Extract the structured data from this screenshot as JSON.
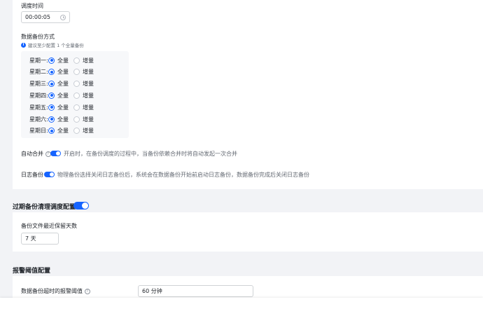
{
  "schedule": {
    "time_label": "调度时间",
    "time_value": "00:00:05"
  },
  "backup_mode": {
    "label": "数据备份方式",
    "hint": "建议至少配置 1 个全量备份",
    "options": {
      "full": "全量",
      "incremental": "增量"
    },
    "days": [
      {
        "label": "星期一:",
        "selected": "full"
      },
      {
        "label": "星期二:",
        "selected": "full"
      },
      {
        "label": "星期三:",
        "selected": "full"
      },
      {
        "label": "星期四:",
        "selected": "full"
      },
      {
        "label": "星期五:",
        "selected": "full"
      },
      {
        "label": "星期六:",
        "selected": "full"
      },
      {
        "label": "星期日:",
        "selected": "full"
      }
    ]
  },
  "auto_merge": {
    "label": "自动合并",
    "enabled": true,
    "description": "开启时，在备份调度的过程中，当备份依赖合并时将自动发起一次合并"
  },
  "log_backup": {
    "label": "日志备份",
    "enabled": true,
    "description": "物理备份选择关闭日志备份后，系统会在数据备份开始前启动日志备份，数据备份完成后关闭日志备份"
  },
  "expired_cleanup": {
    "title": "过期备份清理调度配置",
    "enabled": true,
    "retention_label": "备份文件最近保留天数",
    "retention_value": "7 天"
  },
  "alarm": {
    "title": "报警阈值配置",
    "timeout_label": "数据备份超时的报警阈值",
    "timeout_value": "60 分钟"
  },
  "colors": {
    "accent": "#1664ff",
    "background": "#f2f3f6"
  }
}
